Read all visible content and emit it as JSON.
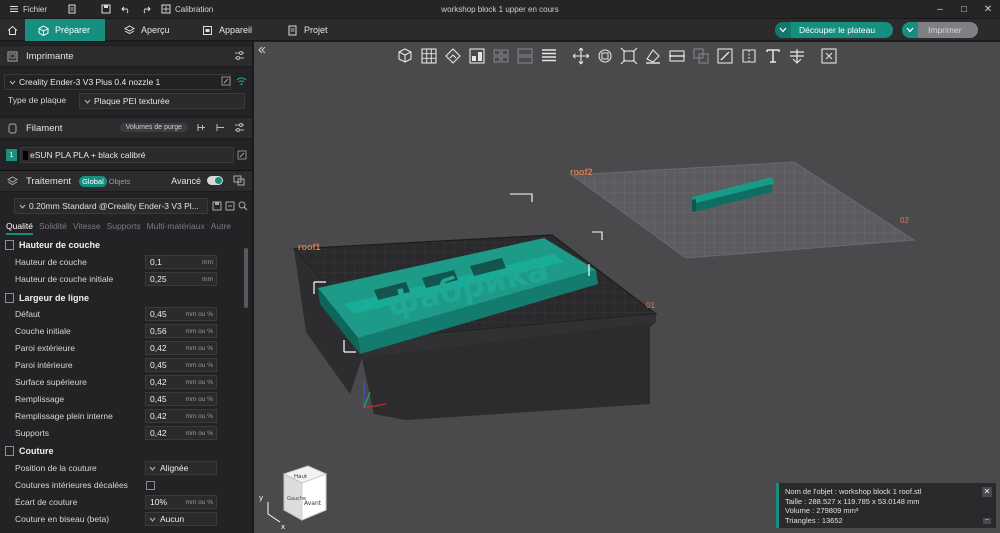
{
  "titlebar": {
    "file_label": "Fichier",
    "calibration_label": "Calibration",
    "window_title": "workshop block 1 upper en cours"
  },
  "tabs": [
    {
      "label": "Préparer",
      "active": true
    },
    {
      "label": "Aperçu"
    },
    {
      "label": "Appareil"
    },
    {
      "label": "Projet"
    }
  ],
  "actions": {
    "slice_label": "Découper le plateau",
    "print_label": "Imprimer"
  },
  "printer": {
    "section_title": "Imprimante",
    "printer_name": "Creality Ender-3 V3 Plus 0.4 nozzle 1",
    "plate_type_label": "Type de plaque",
    "plate_type_value": "Plaque PEI texturée"
  },
  "filament": {
    "section_title": "Filament",
    "purge_label": "Volumes de purge",
    "slot_number": "1",
    "filament_name": "eSUN PLA PLA + black calibré"
  },
  "process": {
    "section_title": "Traitement",
    "mode_global": "Global",
    "mode_objects": "Objets",
    "advanced_label": "Avancé",
    "profile_name": "0.20mm Standard @Creality Ender-3 V3 Pl...",
    "tabs": [
      "Qualité",
      "Solidité",
      "Vitesse",
      "Supports",
      "Multi-matériaux",
      "Autre"
    ]
  },
  "settings": {
    "layer_height_group": "Hauteur de couche",
    "layer_height_label": "Hauteur de couche",
    "layer_height_value": "0,1",
    "initial_layer_height_label": "Hauteur de couche initiale",
    "initial_layer_height_value": "0,25",
    "unit_mm": "mm",
    "line_width_group": "Largeur de ligne",
    "unit_mm_pct": "mm ou %",
    "line_widths": [
      {
        "label": "Défaut",
        "value": "0,45"
      },
      {
        "label": "Couche initiale",
        "value": "0,56"
      },
      {
        "label": "Paroi extérieure",
        "value": "0,42"
      },
      {
        "label": "Paroi intérieure",
        "value": "0,45"
      },
      {
        "label": "Surface supérieure",
        "value": "0,42"
      },
      {
        "label": "Remplissage",
        "value": "0,45"
      },
      {
        "label": "Remplissage plein interne",
        "value": "0,42"
      },
      {
        "label": "Supports",
        "value": "0,42"
      }
    ],
    "seam_group": "Couture",
    "seam_position_label": "Position de la couture",
    "seam_position_value": "Alignée",
    "staggered_seams_label": "Coutures intérieures décalées",
    "seam_gap_label": "Écart de couture",
    "seam_gap_value": "10%",
    "scarf_seam_label": "Couture en biseau (beta)",
    "scarf_seam_value": "Aucun"
  },
  "viewport": {
    "plate1_label": "roof1",
    "plate2_label": "roof2",
    "plate1_corner": "01",
    "plate2_corner": "02",
    "embossed_text": "фабрика",
    "cube_top": "Haut",
    "cube_front": "Avant",
    "cube_left": "Gauche",
    "axis_y": "y",
    "axis_x": "x"
  },
  "object_info": {
    "name_line": "Nom de l'objet : workshop block 1 roof.stl",
    "size_line": "Taille : 288.527 x 119.785 x 53.0148 mm",
    "volume_line": "Volume : 279809 mm³",
    "triangles_line": "Triangles : 13652"
  },
  "colors": {
    "accent": "#168f7f",
    "model": "#1f9a88",
    "panel": "#232325",
    "viewport": "#4a4a4d"
  }
}
